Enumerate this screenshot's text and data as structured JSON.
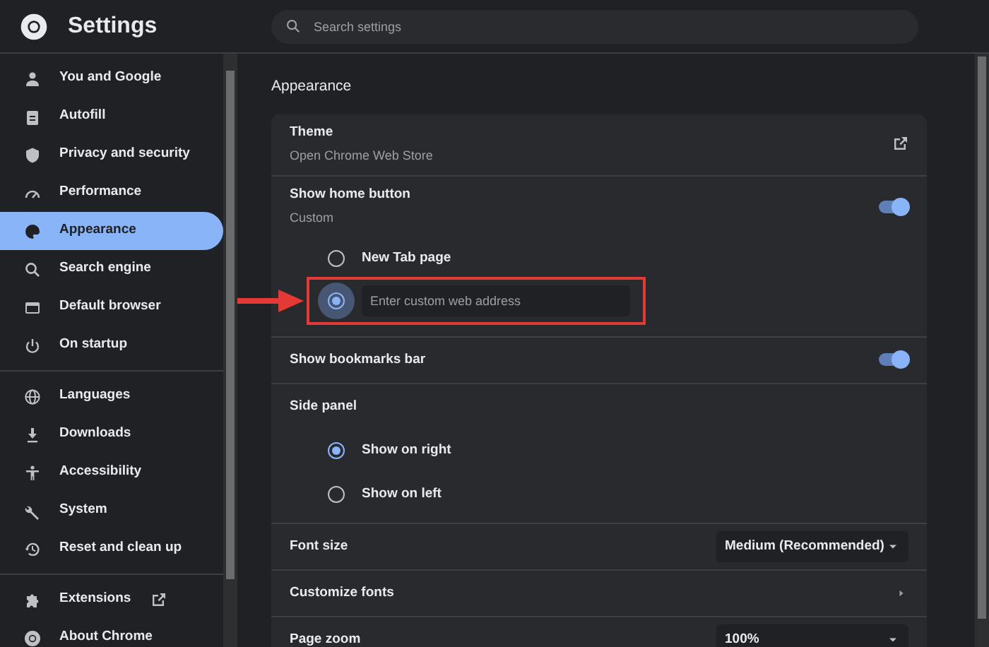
{
  "header": {
    "title": "Settings",
    "search_placeholder": "Search settings"
  },
  "sidebar": {
    "groups": [
      {
        "items": [
          {
            "label": "You and Google",
            "selected": false
          },
          {
            "label": "Autofill",
            "selected": false
          },
          {
            "label": "Privacy and security",
            "selected": false
          },
          {
            "label": "Performance",
            "selected": false
          },
          {
            "label": "Appearance",
            "selected": true
          },
          {
            "label": "Search engine",
            "selected": false
          },
          {
            "label": "Default browser",
            "selected": false
          },
          {
            "label": "On startup",
            "selected": false
          }
        ]
      },
      {
        "items": [
          {
            "label": "Languages",
            "selected": false
          },
          {
            "label": "Downloads",
            "selected": false
          },
          {
            "label": "Accessibility",
            "selected": false
          },
          {
            "label": "System",
            "selected": false
          },
          {
            "label": "Reset and clean up",
            "selected": false
          }
        ]
      },
      {
        "items": [
          {
            "label": "Extensions",
            "selected": false,
            "external": true
          },
          {
            "label": "About Chrome",
            "selected": false
          }
        ]
      }
    ]
  },
  "main": {
    "section_title": "Appearance",
    "rows": [
      {
        "kind": "link",
        "label": "Theme",
        "sublabel": "Open Chrome Web Store"
      },
      {
        "kind": "toggle",
        "label": "Show home button",
        "sublabel": "Custom",
        "on": true,
        "options": [
          {
            "kind": "radio",
            "label": "New Tab page",
            "selected": false
          },
          {
            "kind": "input",
            "placeholder": "Enter custom web address",
            "selected": true,
            "highlighted": true
          }
        ]
      },
      {
        "kind": "toggle",
        "label": "Show bookmarks bar",
        "on": true
      },
      {
        "kind": "radio_group",
        "label": "Side panel",
        "options": [
          {
            "kind": "radio",
            "label": "Show on right",
            "selected": true
          },
          {
            "kind": "radio",
            "label": "Show on left",
            "selected": false
          }
        ]
      },
      {
        "kind": "select",
        "label": "Font size",
        "value": "Medium (Recommended)"
      },
      {
        "kind": "submenu",
        "label": "Customize fonts"
      },
      {
        "kind": "select",
        "label": "Page zoom",
        "value": "100%"
      }
    ]
  }
}
